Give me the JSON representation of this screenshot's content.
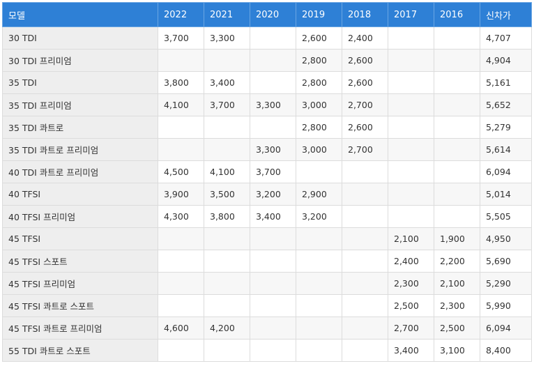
{
  "table": {
    "headers": [
      "모델",
      "2022",
      "2021",
      "2020",
      "2019",
      "2018",
      "2017",
      "2016",
      "신차가"
    ],
    "rows": [
      [
        "30 TDI",
        "3,700",
        "3,300",
        "",
        "2,600",
        "2,400",
        "",
        "",
        "4,707"
      ],
      [
        "30 TDI 프리미엄",
        "",
        "",
        "",
        "2,800",
        "2,600",
        "",
        "",
        "4,904"
      ],
      [
        "35 TDI",
        "3,800",
        "3,400",
        "",
        "2,800",
        "2,600",
        "",
        "",
        "5,161"
      ],
      [
        "35 TDI 프리미엄",
        "4,100",
        "3,700",
        "3,300",
        "3,000",
        "2,700",
        "",
        "",
        "5,652"
      ],
      [
        "35 TDI 콰트로",
        "",
        "",
        "",
        "2,800",
        "2,600",
        "",
        "",
        "5,279"
      ],
      [
        "35 TDI 콰트로 프리미엄",
        "",
        "",
        "3,300",
        "3,000",
        "2,700",
        "",
        "",
        "5,614"
      ],
      [
        "40 TDI 콰트로 프리미엄",
        "4,500",
        "4,100",
        "3,700",
        "",
        "",
        "",
        "",
        "6,094"
      ],
      [
        "40 TFSI",
        "3,900",
        "3,500",
        "3,200",
        "2,900",
        "",
        "",
        "",
        "5,014"
      ],
      [
        "40 TFSI 프리미엄",
        "4,300",
        "3,800",
        "3,400",
        "3,200",
        "",
        "",
        "",
        "5,505"
      ],
      [
        "45 TFSI",
        "",
        "",
        "",
        "",
        "",
        "2,100",
        "1,900",
        "4,950"
      ],
      [
        "45 TFSI 스포트",
        "",
        "",
        "",
        "",
        "",
        "2,400",
        "2,200",
        "5,690"
      ],
      [
        "45 TFSI 프리미엄",
        "",
        "",
        "",
        "",
        "",
        "2,300",
        "2,100",
        "5,290"
      ],
      [
        "45 TFSI 콰트로 스포트",
        "",
        "",
        "",
        "",
        "",
        "2,500",
        "2,300",
        "5,990"
      ],
      [
        "45 TFSI 콰트로 프리미엄",
        "4,600",
        "4,200",
        "",
        "",
        "",
        "2,700",
        "2,500",
        "6,094"
      ],
      [
        "55 TDI 콰트로 스포트",
        "",
        "",
        "",
        "",
        "",
        "3,400",
        "3,100",
        "8,400"
      ]
    ]
  },
  "colors": {
    "header_bg": "#2e80d6",
    "header_text": "#ffffff",
    "model_cell_bg": "#eeeeee",
    "alt_row_bg": "#f7f7f7",
    "border": "#dcdcdc"
  }
}
